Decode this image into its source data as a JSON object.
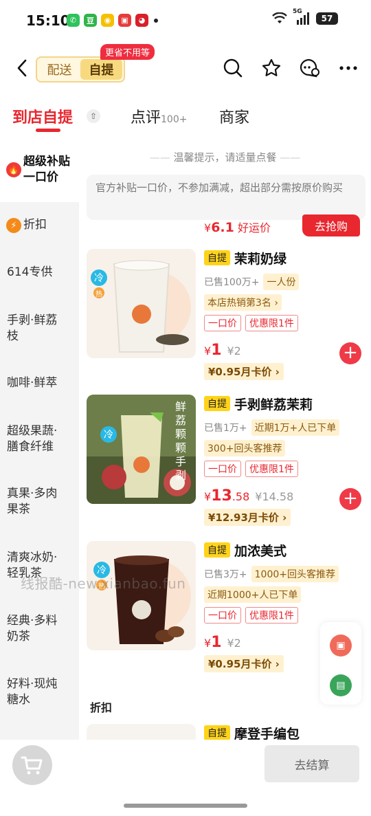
{
  "status": {
    "time": "15:10",
    "network": "5G",
    "battery": "57"
  },
  "nav": {
    "mode_delivery": "配送",
    "mode_pickup": "自提",
    "mode_badge": "更省不用等"
  },
  "tabs": [
    {
      "label": "到店自提"
    },
    {
      "label": "点评",
      "count": "100+"
    },
    {
      "label": "商家"
    }
  ],
  "sidebar": {
    "items": [
      {
        "label": "超级补贴一口价"
      },
      {
        "label": "折扣"
      },
      {
        "label": "614专供"
      },
      {
        "label": "手剥·鲜荔枝"
      },
      {
        "label": "咖啡·鲜萃"
      },
      {
        "label": "超级果蔬·膳食纤维"
      },
      {
        "label": "真果·多肉果茶"
      },
      {
        "label": "清爽冰奶·轻乳茶"
      },
      {
        "label": "经典·多料奶茶"
      },
      {
        "label": "好料·现炖糖水"
      }
    ]
  },
  "content": {
    "tip": "温馨提示，请适量点餐",
    "notice": "官方补贴一口价，不参加满减，超出部分需按原价购买",
    "lucky_currency": "¥",
    "lucky_price": "6.1",
    "lucky_label": "好运价",
    "grab_button": "去抢购",
    "section_discount": "折扣"
  },
  "products": [
    {
      "tag": "自提",
      "name": "茉莉奶绿",
      "sold": "已售100万+",
      "chip": "一人份",
      "rank": "本店热销第3名 ›",
      "promo1": "一口价",
      "promo2": "优惠限1件",
      "currency": "¥",
      "price": "1",
      "price_decimal": "",
      "orig_price": "¥2",
      "card_price": "¥0.95月卡价 ›",
      "temp_cold": "冷",
      "temp_hot": "热"
    },
    {
      "tag": "自提",
      "name": "手剥鲜荔茉莉",
      "sold": "已售1万+",
      "chip": "近期1万+人已下单",
      "rank": "300+回头客推荐",
      "promo1": "一口价",
      "promo2": "优惠限1件",
      "currency": "¥",
      "price": "13",
      "price_decimal": ".58",
      "orig_price": "¥14.58",
      "card_price": "¥12.93月卡价 ›",
      "temp_cold": "冷",
      "img_text": "鲜荔颗颗手剥"
    },
    {
      "tag": "自提",
      "name": "加浓美式",
      "sold": "已售3万+",
      "chip": "1000+回头客推荐",
      "rank": "近期1000+人已下单",
      "promo1": "一口价",
      "promo2": "优惠限1件",
      "currency": "¥",
      "price": "1",
      "price_decimal": "",
      "orig_price": "¥2",
      "card_price": "¥0.95月卡价 ›",
      "temp_cold": "冷",
      "temp_hot": "热"
    },
    {
      "tag": "自提",
      "name": "摩登手编包"
    }
  ],
  "watermark": "线报酷-new.xianbao.fun",
  "bottom": {
    "checkout": "去结算"
  },
  "colors": {
    "accent": "#e8272f",
    "pickup_tag": "#ffd31a",
    "card_bg": "#fff1d0"
  }
}
